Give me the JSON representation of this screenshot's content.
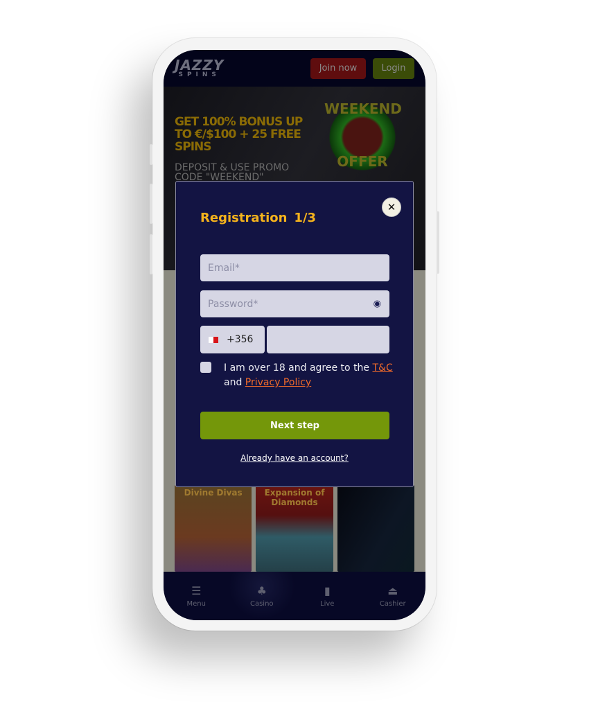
{
  "header": {
    "logo_top": "JAZZY",
    "logo_bottom": "SPINS",
    "join_label": "Join now",
    "login_label": "Login"
  },
  "banner": {
    "headline": "GET 100% BONUS UP TO €/$100 + 25 FREE SPINS",
    "subline": "DEPOSIT & USE PROMO CODE \"WEEKEND\"",
    "badge_top": "WEEKEND",
    "badge_bottom": "OFFER"
  },
  "games": [
    "Divine Divas",
    "Expansion of Diamonds",
    ""
  ],
  "nav": [
    {
      "label": "Menu",
      "icon": "menu-icon"
    },
    {
      "label": "Casino",
      "icon": "cards-icon"
    },
    {
      "label": "Live",
      "icon": "live-card-icon"
    },
    {
      "label": "Cashier",
      "icon": "cashier-icon"
    }
  ],
  "modal": {
    "title": "Registration",
    "step": "1/3",
    "email_placeholder": "Email*",
    "password_placeholder": "Password*",
    "country_code": "+356",
    "agree_text": "I am over 18 and agree to the ",
    "tc_link": "T&C",
    "and_text": " and ",
    "privacy_link": "Privacy Policy",
    "next_label": "Next step",
    "already_label": "Already have an account?"
  },
  "colors": {
    "accent": "#f6b31c",
    "primary_button": "#74970a",
    "modal_bg": "#131443",
    "link": "#f06a2a"
  }
}
